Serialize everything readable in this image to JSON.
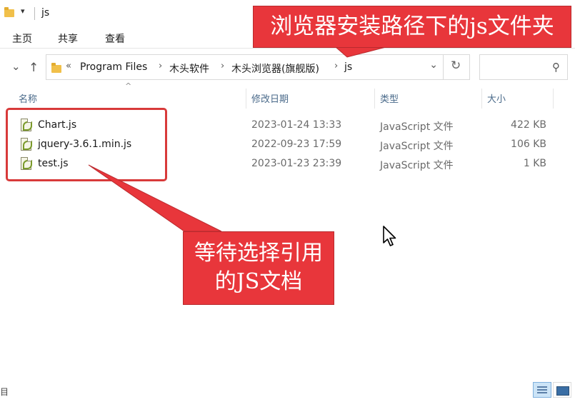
{
  "window": {
    "title": "js",
    "qat_arrow": "▾"
  },
  "ribbon": {
    "tabs": [
      "主页",
      "共享",
      "查看"
    ]
  },
  "address": {
    "overflow": "«",
    "crumbs": [
      "Program Files",
      "木头软件",
      "木头浏览器(旗舰版)",
      "js"
    ],
    "separator": "›",
    "dropdown": "⌄",
    "refresh": "↻"
  },
  "search": {
    "icon": "search-icon",
    "glyph": "⚲"
  },
  "nav": {
    "back_collapse": "⌄",
    "up": "↑"
  },
  "columns": {
    "name": "名称",
    "date": "修改日期",
    "type": "类型",
    "size": "大小",
    "sort_indicator": "^"
  },
  "files": [
    {
      "name": "Chart.js",
      "date": "2023-01-24 13:33",
      "type": "JavaScript 文件",
      "size": "422 KB"
    },
    {
      "name": "jquery-3.6.1.min.js",
      "date": "2022-09-23 17:59",
      "type": "JavaScript 文件",
      "size": "106 KB"
    },
    {
      "name": "test.js",
      "date": "2023-01-23 23:39",
      "type": "JavaScript 文件",
      "size": "1 KB"
    }
  ],
  "annotations": {
    "top_callout": "浏览器安装路径下的js文件夹",
    "bottom_callout_line1": "等待选择引用",
    "bottom_callout_line2": "的JS文档",
    "accent_color": "#e8363b"
  },
  "status": {
    "left_fragment": "目"
  }
}
